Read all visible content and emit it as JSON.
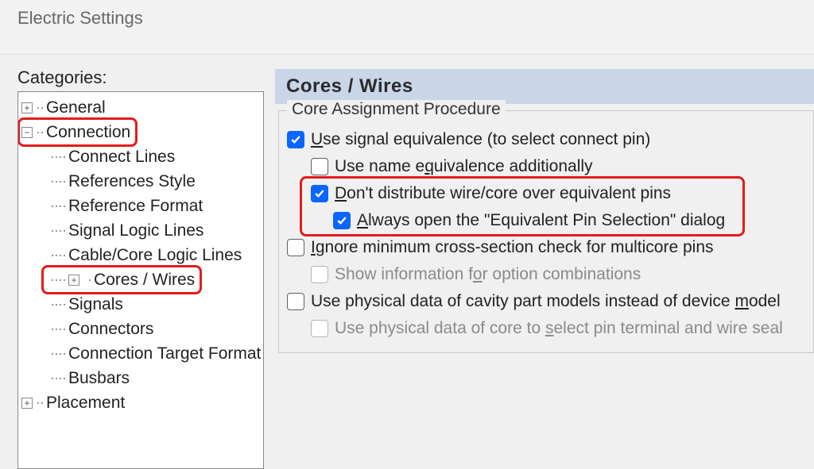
{
  "window": {
    "title": "Electric Settings"
  },
  "sidebar": {
    "label": "Categories:",
    "tree": [
      {
        "label": "General",
        "expandable": true,
        "open": false
      },
      {
        "label": "Connection",
        "expandable": true,
        "open": true,
        "highlight": true,
        "children": [
          {
            "label": "Connect Lines"
          },
          {
            "label": "References Style"
          },
          {
            "label": "Reference Format"
          },
          {
            "label": "Signal Logic Lines"
          },
          {
            "label": "Cable/Core Logic Lines"
          },
          {
            "label": "Cores / Wires",
            "expandable": true,
            "open": false,
            "highlight": true
          },
          {
            "label": "Signals"
          },
          {
            "label": "Connectors"
          },
          {
            "label": "Connection Target Format"
          },
          {
            "label": "Busbars"
          }
        ]
      },
      {
        "label": "Placement",
        "expandable": true,
        "open": false
      }
    ]
  },
  "panel": {
    "title": "Cores / Wires",
    "group_label": "Core Assignment Procedure",
    "opts": {
      "sig_eq": {
        "pre": "",
        "mn": "U",
        "post": "se signal equivalence (to select connect pin)",
        "checked": true,
        "indent": 0,
        "disabled": false
      },
      "name_eq": {
        "pre": "Use name e",
        "mn": "q",
        "post": "uivalence additionally",
        "checked": false,
        "indent": 1,
        "disabled": false
      },
      "no_dist": {
        "pre": "",
        "mn": "D",
        "post": "on't distribute wire/core over equivalent pins",
        "checked": true,
        "indent": 1,
        "disabled": false,
        "highlight_group": true
      },
      "always": {
        "pre": "",
        "mn": "A",
        "post": "lways open the \"Equivalent Pin Selection\" dialog",
        "checked": true,
        "indent": 2,
        "disabled": false
      },
      "ign_min": {
        "pre": "",
        "mn": "I",
        "post": "gnore minimum cross-section check for multicore pins",
        "checked": false,
        "indent": 0,
        "disabled": false
      },
      "show_inf": {
        "pre": "Show information f",
        "mn": "o",
        "post": "r option combinations",
        "checked": false,
        "indent": 1,
        "disabled": true
      },
      "use_phys": {
        "pre": "Use physical data of cavity part models instead of device ",
        "mn": "m",
        "post": "odel",
        "checked": false,
        "indent": 0,
        "disabled": false
      },
      "use_core": {
        "pre": "Use physical data of core to ",
        "mn": "s",
        "post": "elect pin terminal and wire seal",
        "checked": false,
        "indent": 1,
        "disabled": true
      }
    }
  }
}
